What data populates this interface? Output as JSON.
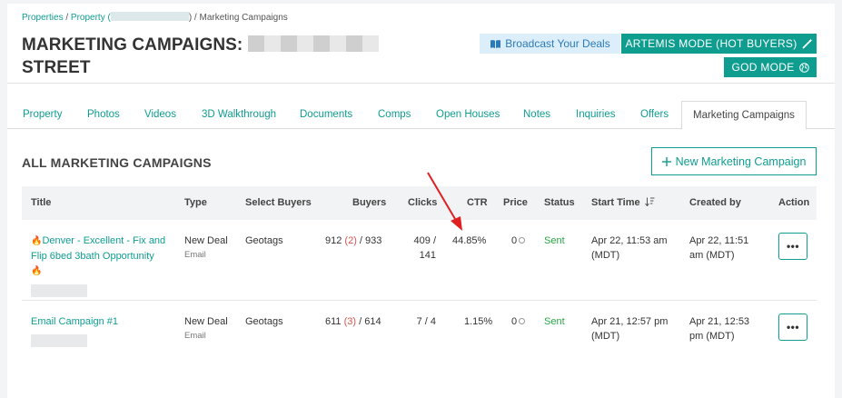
{
  "breadcrumb": {
    "properties": "Properties",
    "sep1": " / ",
    "property": "Property (",
    "property_close": ") / ",
    "current": "Marketing Campaigns"
  },
  "header": {
    "title_line1": "MARKETING CAMPAIGNS:",
    "title_line2": "STREET",
    "broadcast_label": "Broadcast Your Deals",
    "artemis_label": "ARTEMIS MODE (HOT BUYERS)",
    "god_label": "GOD MODE"
  },
  "tabs": [
    {
      "label": "Property"
    },
    {
      "label": "Photos"
    },
    {
      "label": "Videos"
    },
    {
      "label": "3D Walkthrough"
    },
    {
      "label": "Documents"
    },
    {
      "label": "Comps"
    },
    {
      "label": "Open Houses"
    },
    {
      "label": "Notes"
    },
    {
      "label": "Inquiries"
    },
    {
      "label": "Offers"
    },
    {
      "label": "Marketing Campaigns",
      "active": true
    }
  ],
  "section": {
    "title": "ALL MARKETING CAMPAIGNS",
    "new_button": "New Marketing Campaign"
  },
  "table": {
    "columns": [
      "Title",
      "Type",
      "Select Buyers",
      "Buyers",
      "Clicks",
      "CTR",
      "Price",
      "Status",
      "Start Time",
      "Created by",
      "Action"
    ],
    "rows": [
      {
        "title": "Denver - Excellent - Fix and Flip  6bed 3bath Opportunity",
        "type": "New Deal",
        "type_sub": "Email",
        "select_buyers": "Geotags",
        "buyers_a": "912 ",
        "buyers_b": "(2)",
        "buyers_c": " / 933",
        "clicks_a": "409 /",
        "clicks_b": "141",
        "ctr": "44.85%",
        "price": "0",
        "status": "Sent",
        "start_a": "Apr 22, 11:53 am",
        "start_b": "(MDT)",
        "created_a": "Apr 22, 11:51",
        "created_b": "am (MDT)",
        "action": "•••"
      },
      {
        "title": "Email Campaign #1",
        "type": "New Deal",
        "type_sub": "Email",
        "select_buyers": "Geotags",
        "buyers_a": "611 ",
        "buyers_b": "(3)",
        "buyers_c": " / 614",
        "clicks_a": "7 / 4",
        "ctr": "1.15%",
        "price": "0",
        "status": "Sent",
        "start_a": "Apr 21, 12:57 pm",
        "start_b": "(MDT)",
        "created_a": "Apr 21, 12:53",
        "created_b": "pm (MDT)",
        "action": "•••"
      }
    ]
  },
  "colors": {
    "accent": "#0f9d90",
    "broadcast_bg": "#dceefa",
    "broadcast_text": "#2b7bb9",
    "buyers_highlight": "#d9534f",
    "sent": "#28a745",
    "annotation_arrow": "#e02020"
  },
  "icons": {
    "broadcast": "book-icon",
    "artemis": "wand-icon",
    "god": "globe-icon",
    "new": "plus-icon",
    "sort": "sort-descending-icon",
    "price": "coin-icon",
    "flame": "fire-icon"
  }
}
